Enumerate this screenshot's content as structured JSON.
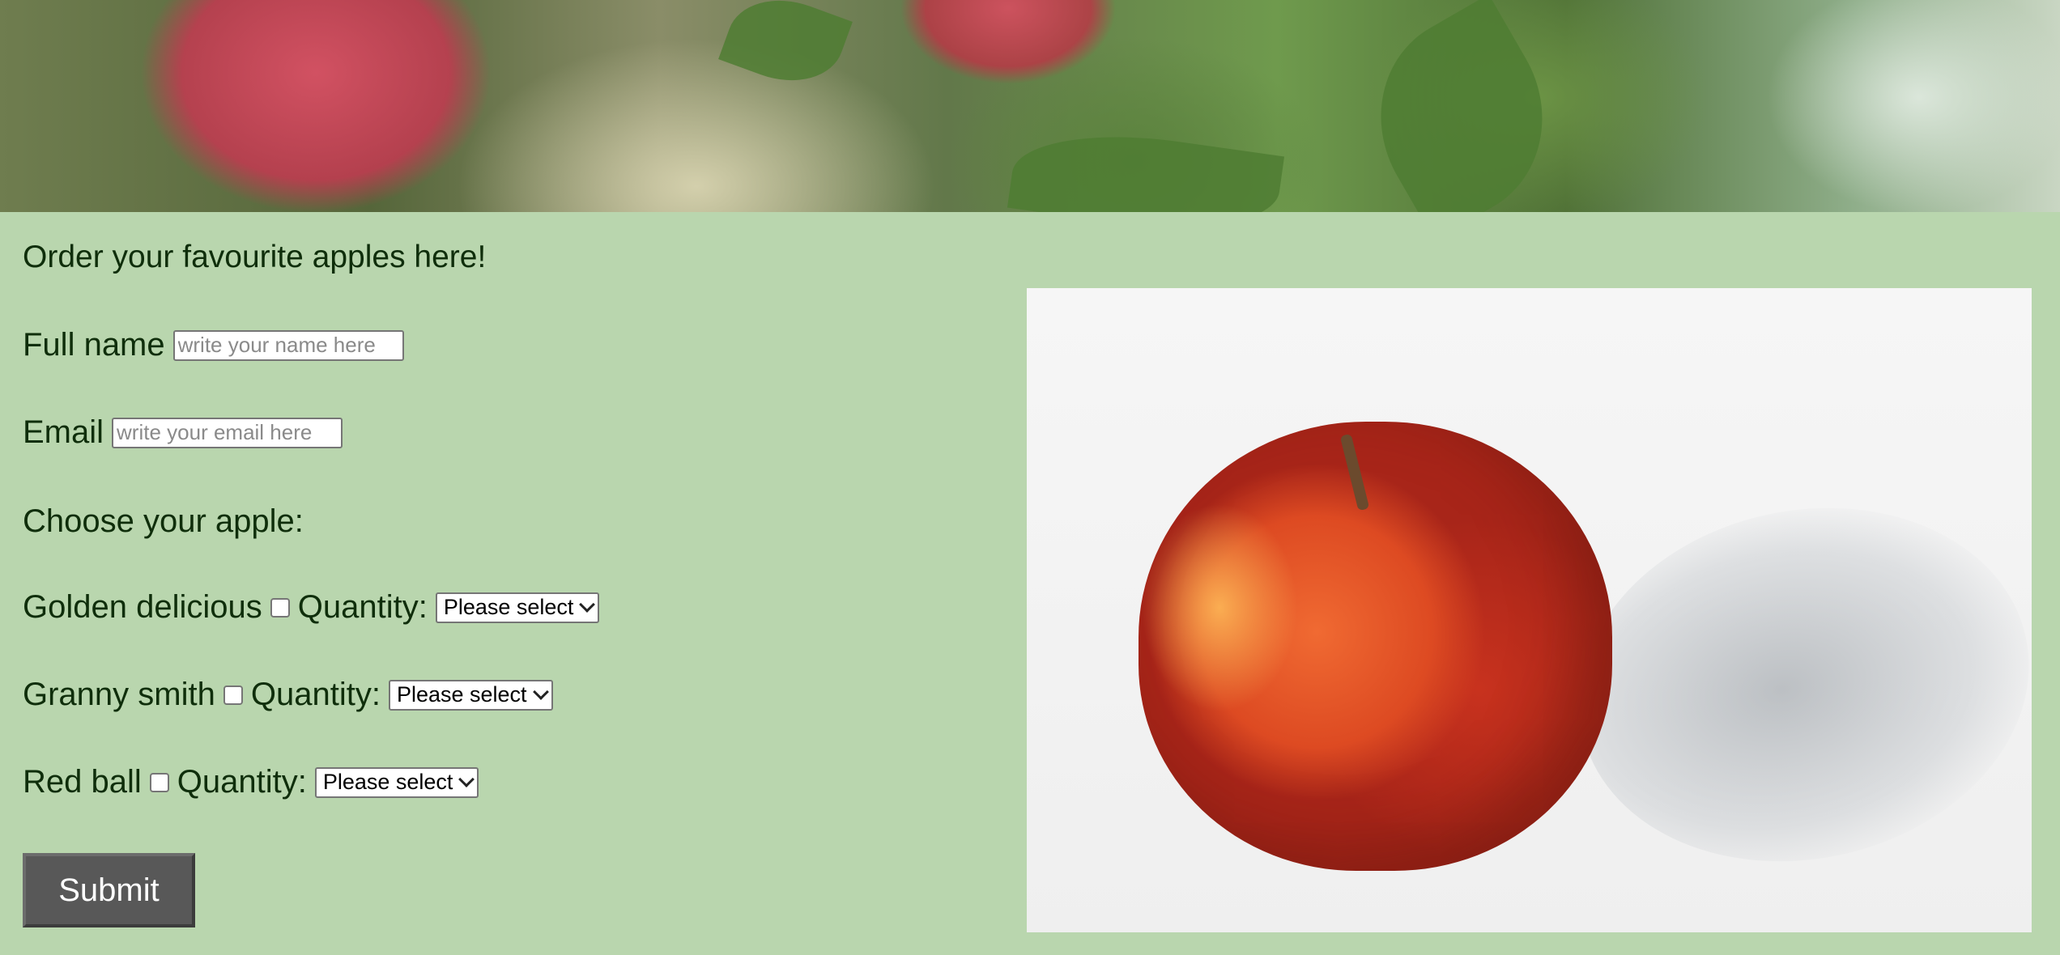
{
  "hero": {
    "image_name": "apple-tree-banner"
  },
  "form": {
    "title": "Order your favourite apples here!",
    "full_name": {
      "label": "Full name",
      "placeholder": "write your name here"
    },
    "email": {
      "label": "Email",
      "placeholder": "write your email here"
    },
    "choose_label": "Choose your apple:",
    "apples": [
      {
        "name": "Golden delicious",
        "quantity_label": "Quantity:",
        "select_value": "Please select"
      },
      {
        "name": "Granny smith",
        "quantity_label": "Quantity:",
        "select_value": "Please select"
      },
      {
        "name": "Red ball",
        "quantity_label": "Quantity:",
        "select_value": "Please select"
      }
    ],
    "submit_label": "Submit"
  },
  "photo": {
    "image_name": "red-apple-photo"
  },
  "colors": {
    "background": "#b9d6ae",
    "text": "#0f2e0b",
    "submit": "#585858"
  }
}
